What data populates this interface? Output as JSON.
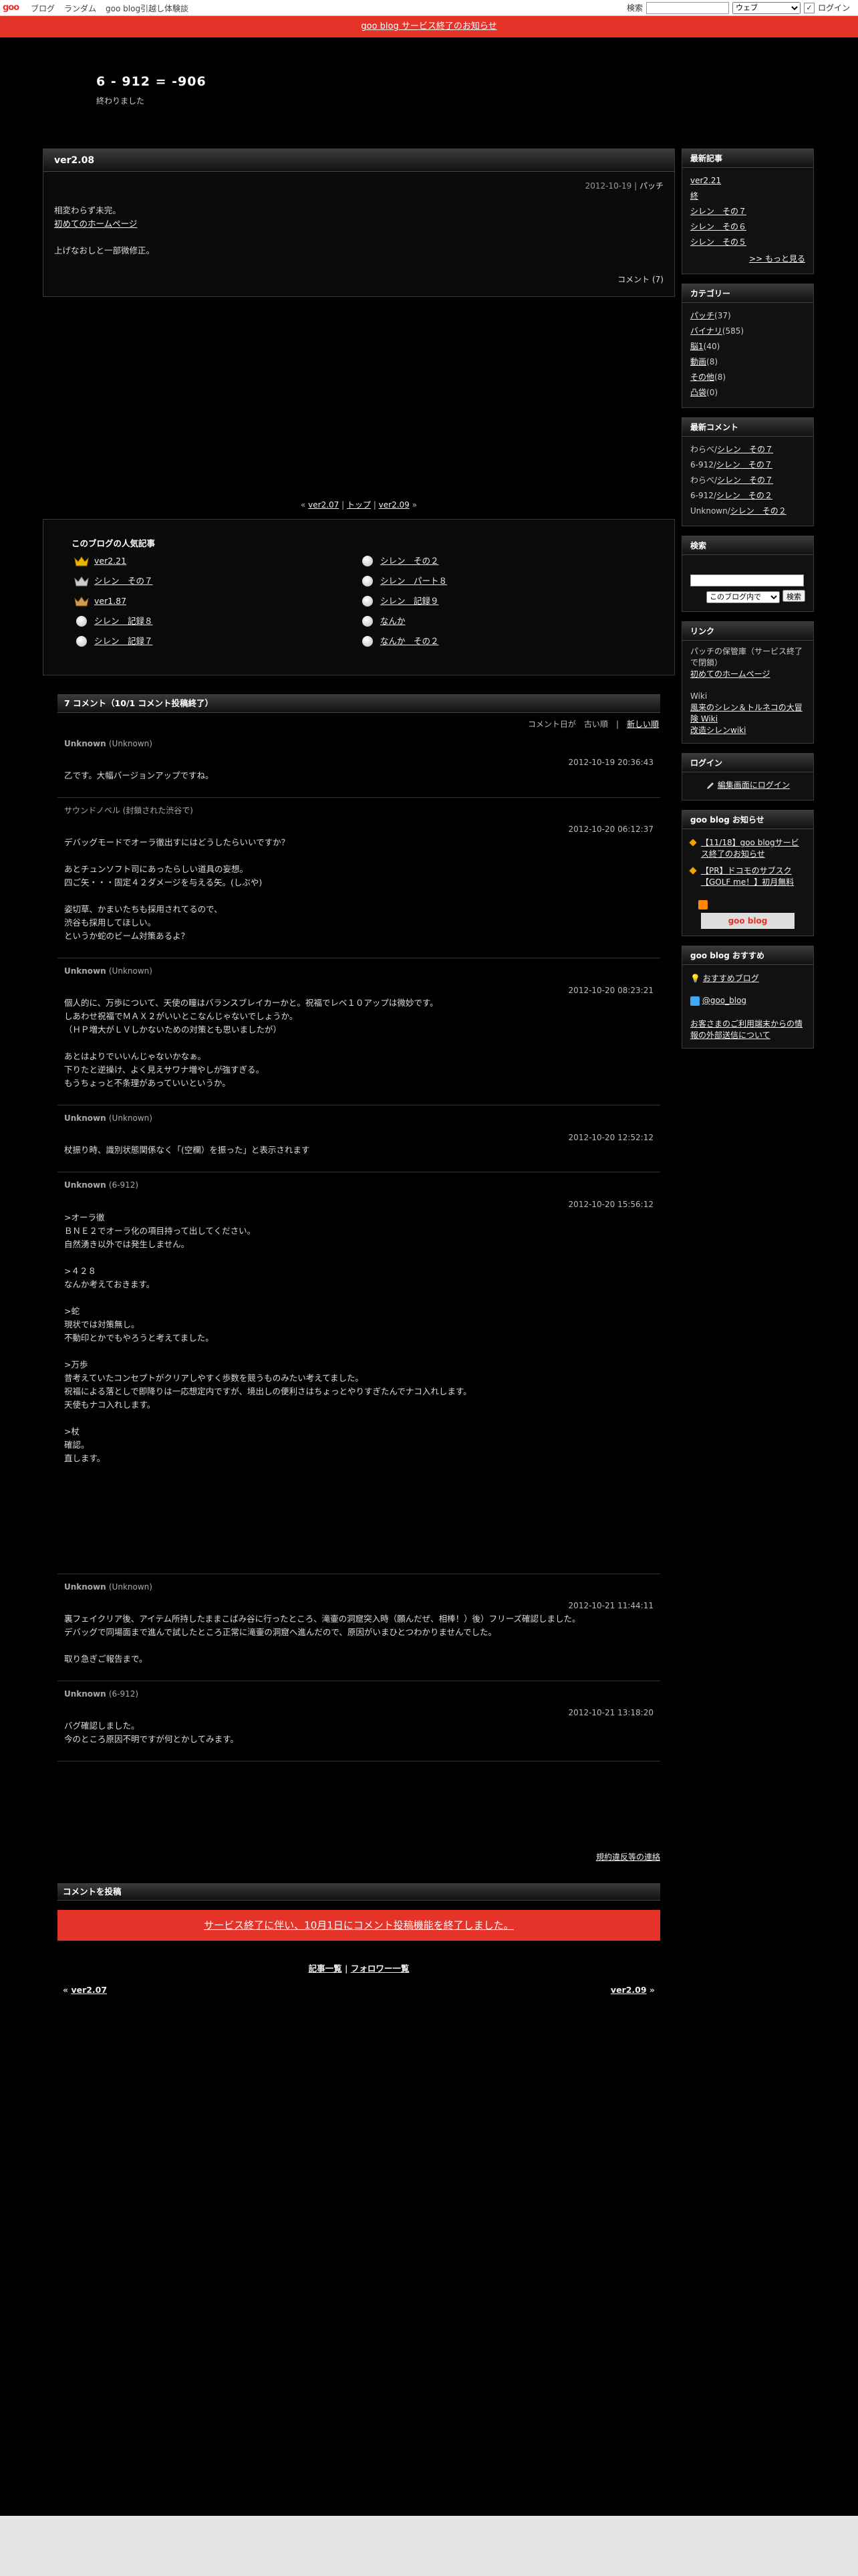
{
  "topbar": {
    "logo": "goo",
    "links": [
      "ブログ",
      "ランダム",
      "goo blog引越し体験談"
    ],
    "search_label": "検索",
    "search_scope": "ウェブ",
    "login": "ログイン"
  },
  "notice": "goo blog サービス終了のお知らせ",
  "blog": {
    "title": "6 - 912 = -906",
    "description": "終わりました"
  },
  "article": {
    "title": "ver2.08",
    "date": "2012-10-19",
    "category": "パッチ",
    "line1": "相変わらず未完。",
    "line2": "初めてのホームページ",
    "line3": "上げなおしと一部微修正。",
    "comment_link": "コメント (7)"
  },
  "pager": {
    "prev": "ver2.07",
    "top": "トップ",
    "next": "ver2.09"
  },
  "popular": {
    "title": "このブログの人気記事",
    "left": [
      "ver2.21",
      "シレン　その７",
      "ver1.87",
      "シレン　記録８",
      "シレン　記録７"
    ],
    "right": [
      "シレン　その２",
      "シレン　パート８",
      "シレン　記録９",
      "なんか",
      "なんか　その２"
    ]
  },
  "comments": {
    "header": "7 コメント（10/1 コメント投稿終了）",
    "order_label": "コメント日が",
    "order_old": "古い順",
    "order_new": "新しい順",
    "items": [
      {
        "name": "Unknown",
        "sub": "(Unknown)",
        "date": "2012-10-19 20:36:43",
        "text": "乙です。大幅バージョンアップですね。"
      },
      {
        "name": "サウンドノベル (封鎖された渋谷で)",
        "sub": "",
        "date": "2012-10-20 06:12:37",
        "text": "デバッグモードでオーラ徹出すにはどうしたらいいですか？\n\nあとチュンソフト司にあったらしい道具の妄想。\n四ご矢・・・固定４２ダメージを与える矢。(しぶや)\n\n姿切草、かまいたちも採用されてるので、\n渋谷も採用してほしい。\nというか蛇のビーム対策あるよ？"
      },
      {
        "name": "Unknown",
        "sub": "(Unknown)",
        "date": "2012-10-20 08:23:21",
        "text": "個人的に、万歩について、天使の瞳はバランスブレイカーかと。祝福でレベ１０アップは微妙です。\nしあわせ祝福でＭＡＸ２がいいとこなんじゃないでしょうか。\n（ＨＰ増大がＬＶしかないための対策とも思いましたが）\n\nあとはよりでいいんじゃないかなぁ。\n下りたと逆操け、よく見えサワナ増やしが強すぎる。\nもうちょっと不条理があっていいというか。"
      },
      {
        "name": "Unknown",
        "sub": "(Unknown)",
        "date": "2012-10-20 12:52:12",
        "text": "杖振り時、識別状態関係なく「(空欄）を振った」と表示されます"
      },
      {
        "name": "Unknown",
        "sub": "(6-912)",
        "date": "2012-10-20 15:56:12",
        "text": ">オーラ徹\nＢＮＥ２でオーラ化の項目持って出してください。\n自然湧き以外では発生しません。\n\n>４２８\nなんか考えておきます。\n\n>蛇\n現状では対策無し。\n不動印とかでもやろうと考えてました。\n\n>万歩\n昔考えていたコンセプトがクリアしやすく歩数を競うものみたい考えてました。\n祝福による落としで即降りは一応想定内ですが、境出しの便利さはちょっとやりすぎたんでナコ入れします。\n天使もナコ入れします。\n\n>杖\n確認。\n直します。\n\n\n\n\n\n\n\n"
      },
      {
        "name": "Unknown",
        "sub": "(Unknown)",
        "date": "2012-10-21 11:44:11",
        "text": "裏フェイクリア後、アイテム所持したままこばみ谷に行ったところ、滝壷の洞窟突入時（願んだぜ、相棒！）後）フリーズ確認しました。\nデバッグで同場面まで進んで試したところ正常に滝壷の洞窟へ進んだので、原因がいまひとつわかりませんでした。\n\n取り急ぎご報告まで。"
      },
      {
        "name": "Unknown",
        "sub": "(6-912)",
        "date": "2012-10-21 13:18:20",
        "text": "バグ確認しました。\n今のところ原因不明ですが何とかしてみます。"
      }
    ],
    "terms": "規約違反等の連絡"
  },
  "post": {
    "header": "コメントを投稿",
    "closed": "サービス終了に伴い、10月1日にコメント投稿機能を終了しました。"
  },
  "bottom": {
    "list": "記事一覧",
    "follow": "フォロワー一覧",
    "prev": "ver2.07",
    "next": "ver2.09"
  },
  "sidebar": {
    "recent": {
      "title": "最新記事",
      "items": [
        "ver2.21",
        "終",
        "シレン　その７",
        "シレン　その６",
        "シレン　その５"
      ],
      "more": ">> もっと見る"
    },
    "category": {
      "title": "カテゴリー",
      "items": [
        {
          "name": "パッチ",
          "count": "(37)"
        },
        {
          "name": "バイナリ",
          "count": "(585)"
        },
        {
          "name": "脳1",
          "count": "(40)"
        },
        {
          "name": "動画",
          "count": "(8)"
        },
        {
          "name": "その他",
          "count": "(8)"
        },
        {
          "name": "凸袋",
          "count": "(0)"
        }
      ]
    },
    "latest": {
      "title": "最新コメント",
      "items": [
        {
          "who": "わらべ/",
          "post": "シレン　その７"
        },
        {
          "who": "6-912/",
          "post": "シレン　その７"
        },
        {
          "who": "わらべ/",
          "post": "シレン　その７"
        },
        {
          "who": "6-912/",
          "post": "シレン　その２"
        },
        {
          "who": "Unknown/",
          "post": "シレン　その２"
        }
      ]
    },
    "search": {
      "title": "検索",
      "scope": "このブログ内で",
      "button": "検索"
    },
    "links": {
      "title": "リンク",
      "l1": "パッチの保管庫（サービス終了で閉鎖）",
      "l2": "初めてのホームページ",
      "wiki": "Wiki",
      "l3": "風来のシレン＆トルネコの大冒険 Wiki",
      "l4": "改造シレンwiki"
    },
    "login": {
      "title": "ログイン",
      "link": "編集画面にログイン"
    },
    "news": {
      "title": "goo blog お知らせ",
      "n1": "【11/18】goo blogサービス終了のお知らせ",
      "n2": "【PR】ドコモのサブスク【GOLF me！】初月無料",
      "badge": "goo blog"
    },
    "recommend": {
      "title": "goo blog おすすめ",
      "item": "おすすめブログ",
      "twitter": "@goo_blog",
      "privacy": "お客さまのご利用端末からの情報の外部送信について"
    }
  }
}
